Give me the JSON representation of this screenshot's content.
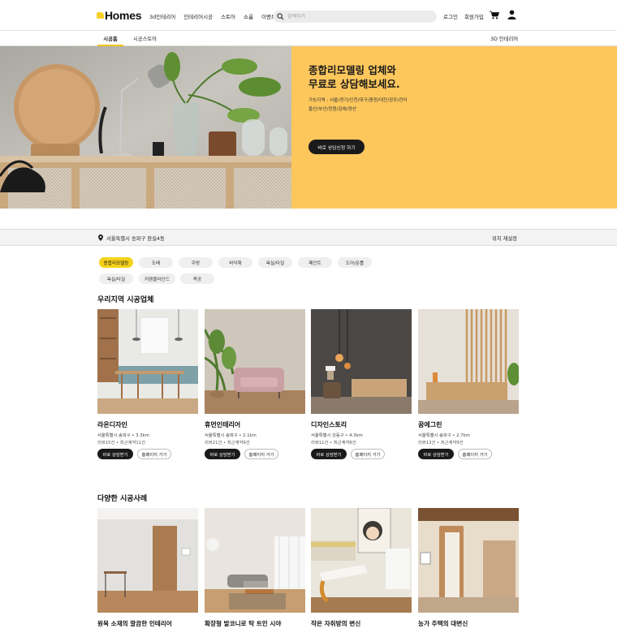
{
  "header": {
    "logo": "Homes",
    "nav": [
      "3d인테리어",
      "인테리어시공",
      "스토어",
      "쇼룸",
      "이벤트"
    ],
    "search_placeholder": "검색하기",
    "login": "로그인",
    "signup": "회원가입"
  },
  "subnav": {
    "tabs": [
      "시공홈",
      "시공스토어"
    ],
    "right_tab": "3D 인테리어"
  },
  "hero": {
    "title_line1": "종합리모델링 업체와",
    "title_line2": "무료로 상담해보세요.",
    "areas_line1": "가능지역 : 서울/경기/인천/대구/충청/대전/광주/전라",
    "areas_line2": "울산/부산/창원/김해/양산",
    "cta": "바로 상담신청 하기"
  },
  "location": {
    "address": "서울특별시 송파구 잠실4동",
    "reset": "위치 재설정"
  },
  "categories": {
    "row1": [
      "종합리모델링",
      "도배",
      "주방",
      "바닥재",
      "욕실/타일",
      "페인트",
      "도어/문틀"
    ],
    "row2": [
      "욕실/타일",
      "커텐블라인드",
      "목공"
    ],
    "active_index": 0
  },
  "companies": {
    "title": "우리지역 시공업체",
    "items": [
      {
        "name": "라온디자인",
        "address": "서울특별시 송파구 • 3.3km",
        "stats": "리뷰15건 • 최근계약11건",
        "consult": "바로 상담받기",
        "homepage": "홈페이지 가기"
      },
      {
        "name": "휴먼인테리어",
        "address": "서울특별시 송파구 • 2.1km",
        "stats": "리뷰21건 • 최근계약9건",
        "consult": "바로 상담받기",
        "homepage": "홈페이지 가기"
      },
      {
        "name": "디자인스토리",
        "address": "서울특별시 강동구 • 4.3km",
        "stats": "리뷰11건 • 최근계약8건",
        "consult": "바로 상담받기",
        "homepage": "홈페이지 가기"
      },
      {
        "name": "꿈에그린",
        "address": "서울특별시 송파구 • 2.7km",
        "stats": "리뷰13건 • 최근계약9건",
        "consult": "바로 상담받기",
        "homepage": "홈페이지 가기"
      }
    ]
  },
  "cases": {
    "title": "다양한 시공사례",
    "items": [
      {
        "title": "원목 소재의 깔끔한 인테리어"
      },
      {
        "title": "확장형 발코니로 탁 트인 시야"
      },
      {
        "title": "작은 자취방의 변신"
      },
      {
        "title": "농가 주택의 대변신"
      }
    ]
  },
  "colors": {
    "accent": "#f5d21c",
    "hero_bg": "#fdc75c",
    "dark": "#1a1a1a"
  }
}
